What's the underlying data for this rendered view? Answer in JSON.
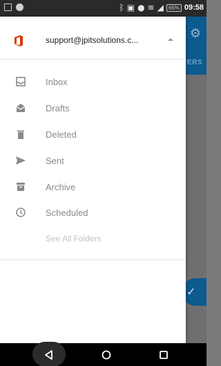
{
  "status_bar": {
    "battery": "66%",
    "time": "09:58",
    "icons": [
      "bluetooth-icon",
      "nfc-icon",
      "alarm-icon",
      "wifi-icon",
      "signal-icon"
    ]
  },
  "background": {
    "tab_fragment": "TERS"
  },
  "drawer": {
    "account_email": "support@jpitsolutions.c...",
    "folders": [
      {
        "label": "Inbox",
        "icon": "inbox-icon"
      },
      {
        "label": "Drafts",
        "icon": "drafts-icon"
      },
      {
        "label": "Deleted",
        "icon": "trash-icon"
      },
      {
        "label": "Sent",
        "icon": "send-icon"
      },
      {
        "label": "Archive",
        "icon": "archive-icon"
      },
      {
        "label": "Scheduled",
        "icon": "clock-icon"
      }
    ],
    "see_all_label": "See All Folders"
  },
  "colors": {
    "brand_blue": "#0d5a8f",
    "office_red": "#d83b01",
    "icon_gray": "#8a8a8a"
  }
}
